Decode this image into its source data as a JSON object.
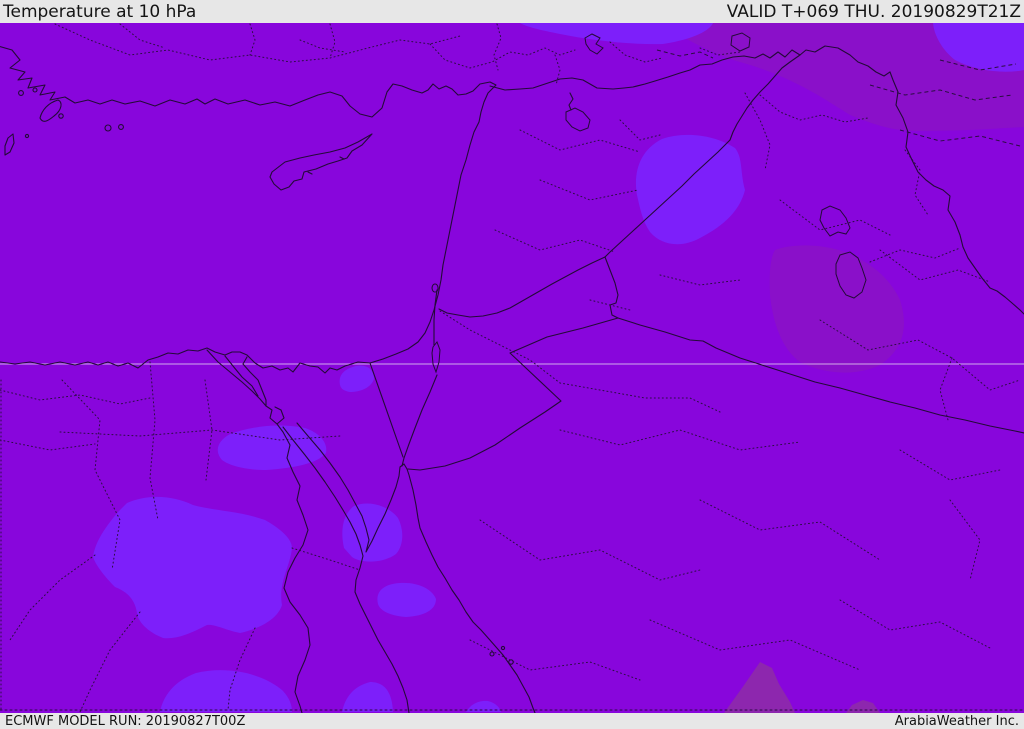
{
  "header": {
    "title": "Temperature at 10 hPa",
    "valid_label": "VALID T+069 THU. 20190829T21Z"
  },
  "footer": {
    "model_run": "ECMWF MODEL RUN: 20190827T00Z",
    "brand": "ArabiaWeather Inc."
  },
  "map": {
    "kind": "temperature-forecast-map",
    "region": "Middle East"
  },
  "colors": {
    "bar-bg": "#e7e7e7",
    "bar-text": "#141414",
    "base": "#8806dc",
    "bright": "#7d1ffa",
    "darkband": "#8a10c9",
    "darkest": "#8d27ae",
    "line": "#240a38",
    "dot": "#2b0d42",
    "grid": "#e3d2f0"
  }
}
